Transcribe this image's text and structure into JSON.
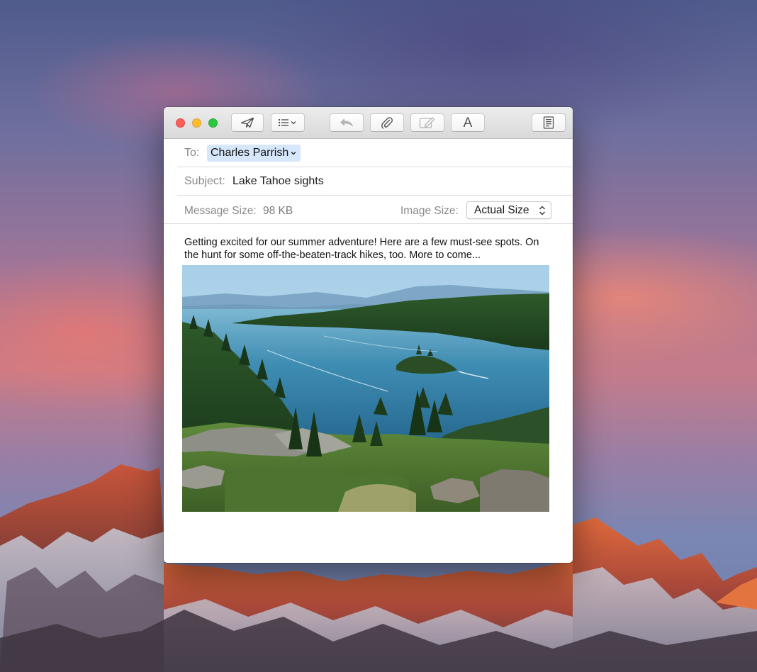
{
  "toolbar": {
    "send": "send-icon",
    "header_options": "list-icon",
    "reply": "reply-icon",
    "attach": "paperclip-icon",
    "markup": "markup-icon",
    "fonts_label": "A",
    "photo_browser": "photo-icon",
    "stationery": "template-icon"
  },
  "compose": {
    "to_label": "To:",
    "to_recipient": "Charles Parrish",
    "subject_label": "Subject:",
    "subject_value": "Lake Tahoe sights",
    "message_size_label": "Message Size:",
    "message_size_value": "98 KB",
    "image_size_label": "Image Size:",
    "image_size_value": "Actual Size",
    "body_text": "Getting excited for our summer adventure! Here are a few must-see spots. On the hunt for some off-the-beaten-track hikes, too. More to come..."
  },
  "colors": {
    "close": "#fc5f57",
    "minimize": "#fdbc2e",
    "zoom": "#29c840",
    "recipient_token": "#d6e6fb"
  }
}
